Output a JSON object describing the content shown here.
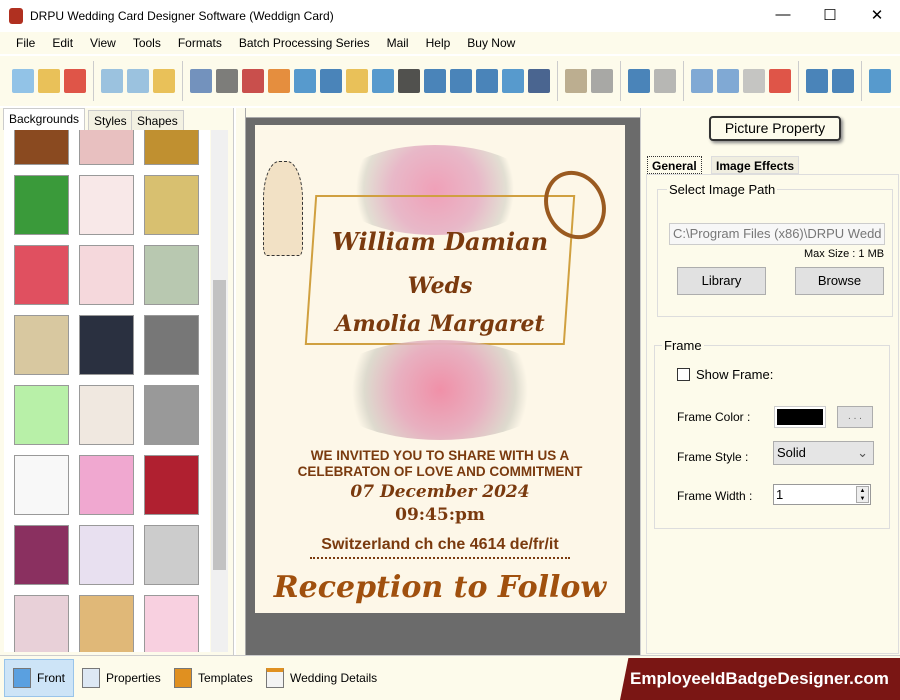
{
  "window": {
    "title": "DRPU Wedding Card Designer Software (Weddign Card)",
    "minimize": "—",
    "maximize": "☐",
    "close": "✕"
  },
  "menu": [
    "File",
    "Edit",
    "View",
    "Tools",
    "Formats",
    "Batch Processing Series",
    "Mail",
    "Help",
    "Buy Now"
  ],
  "toolbar": {
    "icons": [
      "new-icon",
      "open-icon",
      "close-icon",
      "save-icon",
      "save-as-icon",
      "export-icon",
      "page-icon",
      "print-icon",
      "copy-pages-icon",
      "gift-icon",
      "insert-image-icon",
      "pen-icon",
      "shapes-icon",
      "watermark-icon",
      "barcode-icon",
      "text-icon",
      "word-art-icon",
      "signature-icon",
      "mail-icon",
      "line-icon",
      "database-icon",
      "database2-icon",
      "undo-icon",
      "redo-icon",
      "cut-icon",
      "copy-icon",
      "paste-icon",
      "delete-icon",
      "bring-front-icon",
      "send-back-icon",
      "grid-icon"
    ],
    "colors": [
      "#7fb8e6",
      "#e5b640",
      "#d9372c",
      "#8ab7dd",
      "#8ab7dd",
      "#e5b640",
      "#5b7fb5",
      "#666",
      "#c03030",
      "#e07a20",
      "#3a88c8",
      "#2a6fb0",
      "#e5b640",
      "#3a88c8",
      "#333",
      "#2a6fb0",
      "#2a6fb0",
      "#2a6fb0",
      "#3a88c8",
      "#2a4a80",
      "#b0a080",
      "#999",
      "#2a6fb0",
      "#aaa",
      "#6a9ad0",
      "#6a9ad0",
      "#bbb",
      "#d9372c",
      "#2a6fb0",
      "#2a6fb0",
      "#3a88c8"
    ]
  },
  "left_panel": {
    "tabs": [
      "Backgrounds",
      "Styles",
      "Shapes"
    ],
    "active_tab": "Backgrounds",
    "thumbnails": [
      "#8a4a20",
      "#e8c0c0",
      "#c09030",
      "#3a9a3a",
      "#f8e8e8",
      "#d8c070",
      "#e05060",
      "#f5d8dc",
      "#b8c8b0",
      "#d8c8a0",
      "#2a3040",
      "#777",
      "#b8f0a8",
      "#f0e8e0",
      "#999",
      "#f8f8f8",
      "#f0a8d0",
      "#b02030",
      "#8a3060",
      "#e8e0f0",
      "#ccc",
      "#e8d0d8",
      "#e0b878",
      "#f8d0e0"
    ]
  },
  "card": {
    "groom": "William Damian",
    "weds": "Weds",
    "bride": "Amolia Margaret",
    "invite_line1": "WE INVITED YOU TO SHARE WITH US A",
    "invite_line2": "CELEBRATON OF LOVE AND COMMITMENT",
    "date": "07 December 2024",
    "time": "09:45:pm",
    "venue": "Switzerland ch che 4614 de/fr/it",
    "reception": "Reception to Follow"
  },
  "right_panel": {
    "title": "Picture Property",
    "tabs": [
      "General",
      "Image Effects"
    ],
    "active_tab": "General",
    "image_path": {
      "legend": "Select Image Path",
      "value": "C:\\Program Files (x86)\\DRPU Wedd",
      "max_size": "Max Size : 1 MB",
      "library": "Library",
      "browse": "Browse"
    },
    "frame": {
      "legend": "Frame",
      "show_frame": "Show Frame:",
      "show_frame_checked": false,
      "color_label": "Frame Color :",
      "color": "#000000",
      "color_button": ". . .",
      "style_label": "Frame Style :",
      "style": "Solid",
      "width_label": "Frame Width :",
      "width": "1"
    }
  },
  "bottom": {
    "tabs": [
      "Front",
      "Properties",
      "Templates",
      "Wedding Details"
    ],
    "active_tab": "Front",
    "brand": "EmployeeIdBadgeDesigner.com"
  }
}
